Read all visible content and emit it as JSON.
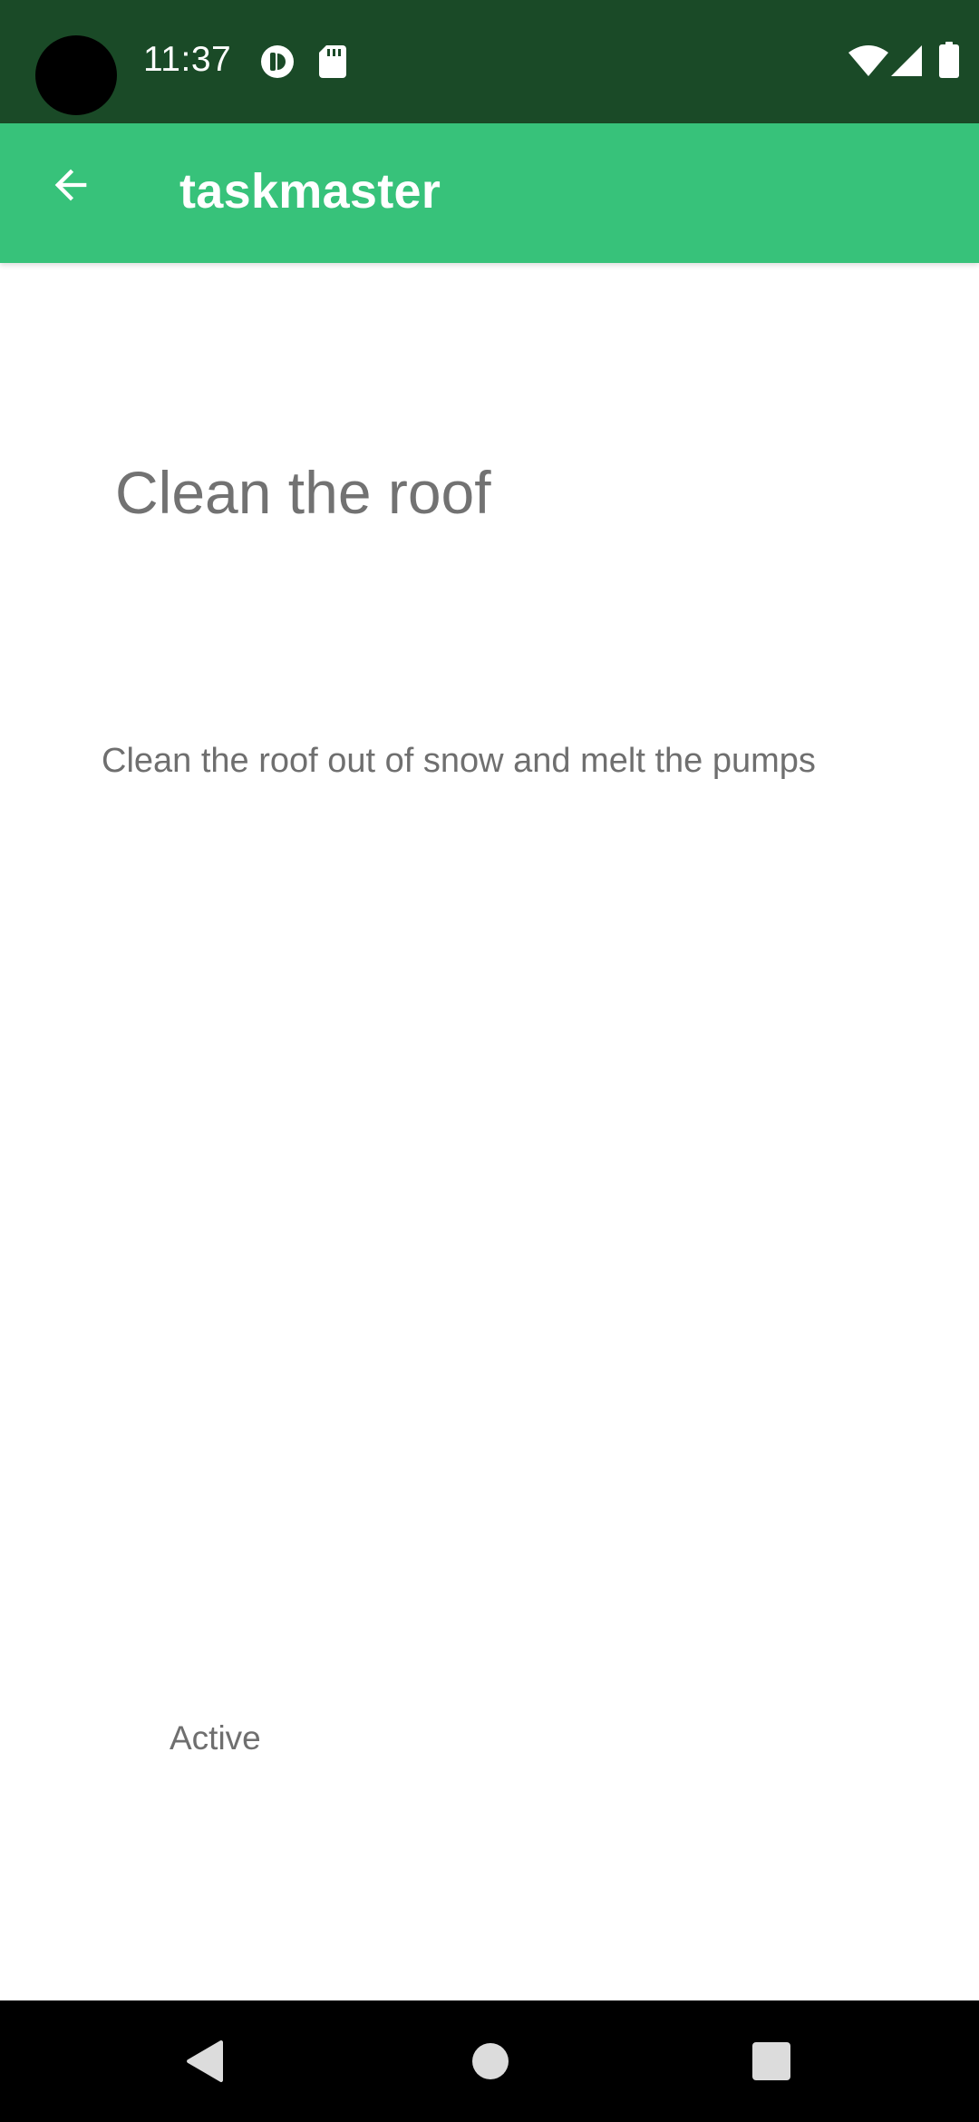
{
  "status_bar": {
    "time": "11:37",
    "background": "#1a4a27",
    "icons": [
      "camera-cutout",
      "notification-icon",
      "sd-card-icon",
      "wifi-icon",
      "signal-icon",
      "battery-icon"
    ]
  },
  "app_bar": {
    "title": "taskmaster",
    "back_icon": "arrow-left-icon",
    "background": "#37c27a"
  },
  "task": {
    "title": "Clean the roof",
    "body": "Clean the roof out of snow and melt the pumps",
    "state": "Active"
  },
  "nav_bar": {
    "buttons": [
      "back-triangle-icon",
      "home-circle-icon",
      "recents-square-icon"
    ],
    "background": "#000000"
  },
  "colors": {
    "text_secondary": "#727272",
    "text_body": "#6f6f6f",
    "nav_icon": "#dcdcdc"
  }
}
